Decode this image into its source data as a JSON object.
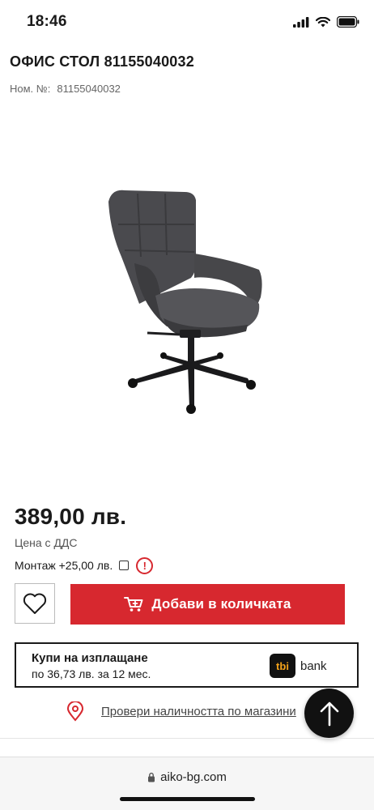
{
  "status_bar": {
    "time": "18:46"
  },
  "product": {
    "title": "ОФИС СТОЛ 81155040032",
    "sku_label": "Ном. №:",
    "sku_value": "81155040032",
    "price": "389,00 лв.",
    "vat_note": "Цена с ДДС",
    "assembly_label": "Монтаж +25,00 лв.",
    "assembly_checked": false
  },
  "actions": {
    "add_to_cart_label": "Добави в количката"
  },
  "installment": {
    "title": "Купи на изплащане",
    "detail": "по 36,73 лв. за 12 мес.",
    "logo_text": "tbi",
    "bank_text": "bank"
  },
  "availability": {
    "link_label": "Провери наличността по магазини"
  },
  "browser": {
    "url": "aiko-bg.com"
  },
  "colors": {
    "accent": "#d7282f",
    "text": "#1a1a1a",
    "tbi_orange": "#f5a31a"
  },
  "icons": [
    "signal-icon",
    "wifi-icon",
    "battery-icon",
    "heart-icon",
    "cart-icon",
    "info-icon",
    "location-pin-icon",
    "arrow-up-icon",
    "lock-icon"
  ]
}
